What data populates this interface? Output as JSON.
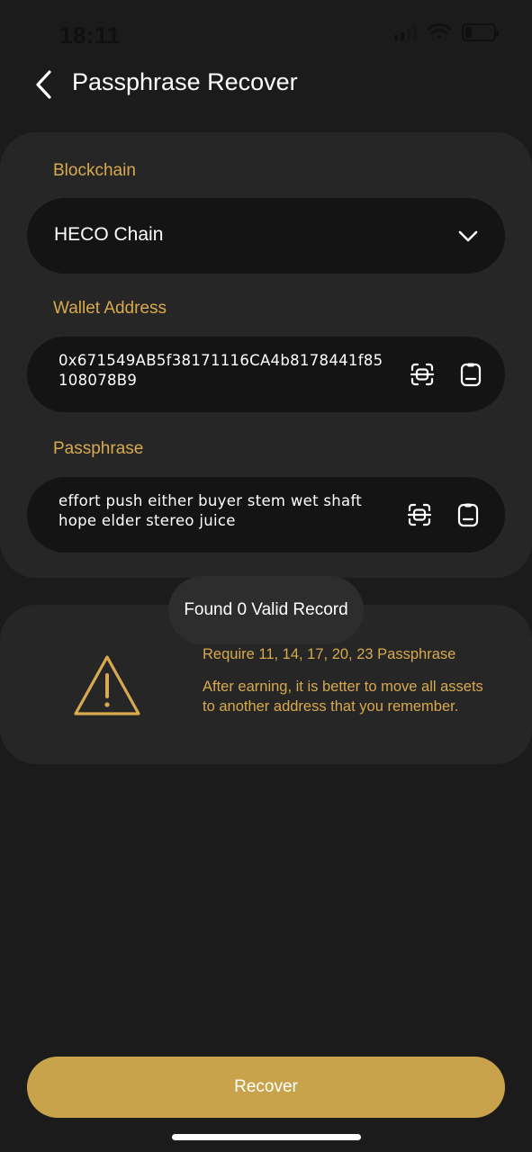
{
  "status_bar": {
    "time": "18:11",
    "icons": [
      "signal-icon",
      "wifi-icon",
      "battery-icon"
    ]
  },
  "header": {
    "title": "Passphrase Recover",
    "back_icon": "chevron-left-icon"
  },
  "form": {
    "blockchain_label": "Blockchain",
    "blockchain_value": "HECO Chain",
    "wallet_label": "Wallet Address",
    "wallet_value": "0x671549AB5f38171116CA4b8178441f85108078B9",
    "passphrase_label": "Passphrase",
    "passphrase_value": "effort push either buyer stem wet shaft hope elder stereo juice"
  },
  "toast": {
    "text": "Found 0 Valid Record"
  },
  "info": {
    "line1": "Require 11, 14, 17, 20, 23 Passphrase",
    "line2": "After earning, it is better to move all assets to another address that you remember."
  },
  "actions": {
    "recover_label": "Recover"
  },
  "colors": {
    "background": "#1b1b1b",
    "card": "#262626",
    "field": "#141414",
    "accent": "#d8a94e",
    "button": "#c9a34b"
  }
}
